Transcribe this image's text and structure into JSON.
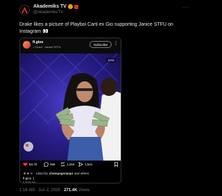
{
  "tweet": {
    "display_name": "Akademiks TV",
    "handle": "@AkademiksTV",
    "text": "Drake likes a picture of Playboi Carti ex Gio supporting Janice STFU on Instagram 👀",
    "time": "1:16 AM",
    "date": "Jun 2, 2026",
    "separator": "·",
    "views_count": "271.4K",
    "views_label": "Views"
  },
  "instagram": {
    "username": "ft.gioo",
    "subtitle": "♪ Cruza · Janice STFU",
    "subscribe_label": "Subscribe",
    "media_counter": "10/11",
    "likes": "83.7K",
    "comments": "266",
    "reposts": "1,344",
    "shares": "1,541",
    "liked_by_prefix": "Liked by",
    "liked_by_user": "champagnepapi",
    "liked_by_suffix": "and others",
    "caption": "ft.gioo :)",
    "posted_ago": "6 hours ago"
  },
  "colors": {
    "background": "#000000",
    "text": "#e7e9ea",
    "muted": "#71767b",
    "verified_badge": "#e0a800",
    "like_red": "#ff3040",
    "media_purple": "#3a2db0"
  }
}
